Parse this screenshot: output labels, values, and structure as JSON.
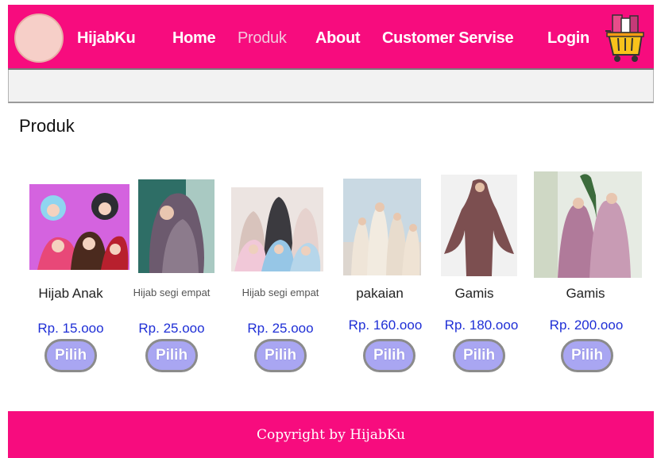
{
  "header": {
    "brand": "HijabKu",
    "nav": [
      "Home",
      "Produk",
      "About",
      "Customer Servise",
      "Login"
    ],
    "active_nav": "Produk",
    "accent_color": "#f70c7e"
  },
  "section_title": "Produk",
  "products": [
    {
      "name": "Hijab Anak",
      "price": "Rp. 15.ooo",
      "button": "Pilih"
    },
    {
      "name": "Hijab segi empat",
      "price": "Rp. 25.ooo",
      "button": "Pilih"
    },
    {
      "name": "Hijab segi empat",
      "price": "Rp. 25.ooo",
      "button": "Pilih"
    },
    {
      "name": "pakaian",
      "price": "Rp. 160.ooo",
      "button": "Pilih"
    },
    {
      "name": "Gamis",
      "price": "Rp. 180.ooo",
      "button": "Pilih"
    },
    {
      "name": "Gamis",
      "price": "Rp. 200.ooo",
      "button": "Pilih"
    }
  ],
  "footer": {
    "text": "Copyright by HijabKu"
  },
  "icons": {
    "cart": "shopping-basket-icon",
    "logo": "logo-circle"
  }
}
